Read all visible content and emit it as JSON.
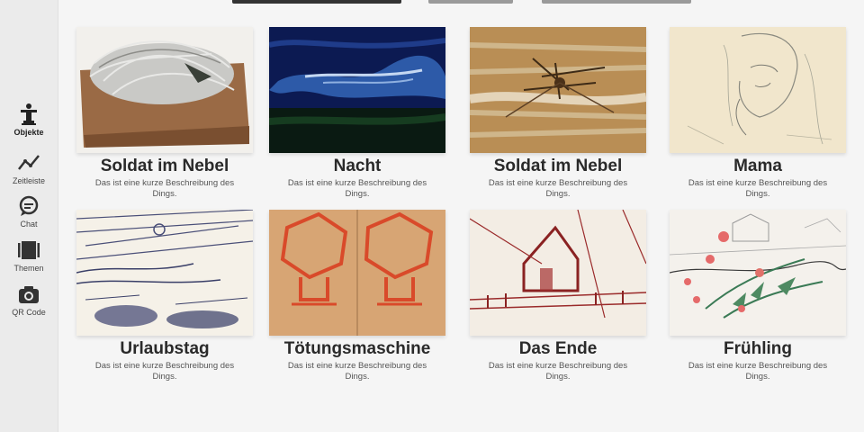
{
  "sidebar": {
    "items": [
      {
        "label": "Objekte",
        "icon": "statue-icon",
        "active": true
      },
      {
        "label": "Zeitleiste",
        "icon": "timeline-icon",
        "active": false
      },
      {
        "label": "Chat",
        "icon": "chat-icon",
        "active": false
      },
      {
        "label": "Themen",
        "icon": "themes-icon",
        "active": false
      },
      {
        "label": "QR Code",
        "icon": "camera-icon",
        "active": false
      }
    ]
  },
  "tabs": {
    "active_color": "#333333",
    "inactive_color": "#9a9a9a"
  },
  "gallery": {
    "items": [
      {
        "title": "Soldat im Nebel",
        "description": "Das ist eine kurze Beschreibung des Dings."
      },
      {
        "title": "Nacht",
        "description": "Das ist eine kurze Beschreibung des Dings."
      },
      {
        "title": "Soldat im Nebel",
        "description": "Das ist eine kurze Beschreibung des Dings."
      },
      {
        "title": "Mama",
        "description": "Das ist eine kurze Beschreibung des Dings."
      },
      {
        "title": "Urlaubstag",
        "description": "Das ist eine kurze Beschreibung des Dings."
      },
      {
        "title": "Tötungsmaschine",
        "description": "Das ist eine kurze Beschreibung des Dings."
      },
      {
        "title": "Das Ende",
        "description": "Das ist eine kurze Beschreibung des Dings."
      },
      {
        "title": "Frühling",
        "description": "Das ist eine kurze Beschreibung des Dings."
      }
    ]
  }
}
